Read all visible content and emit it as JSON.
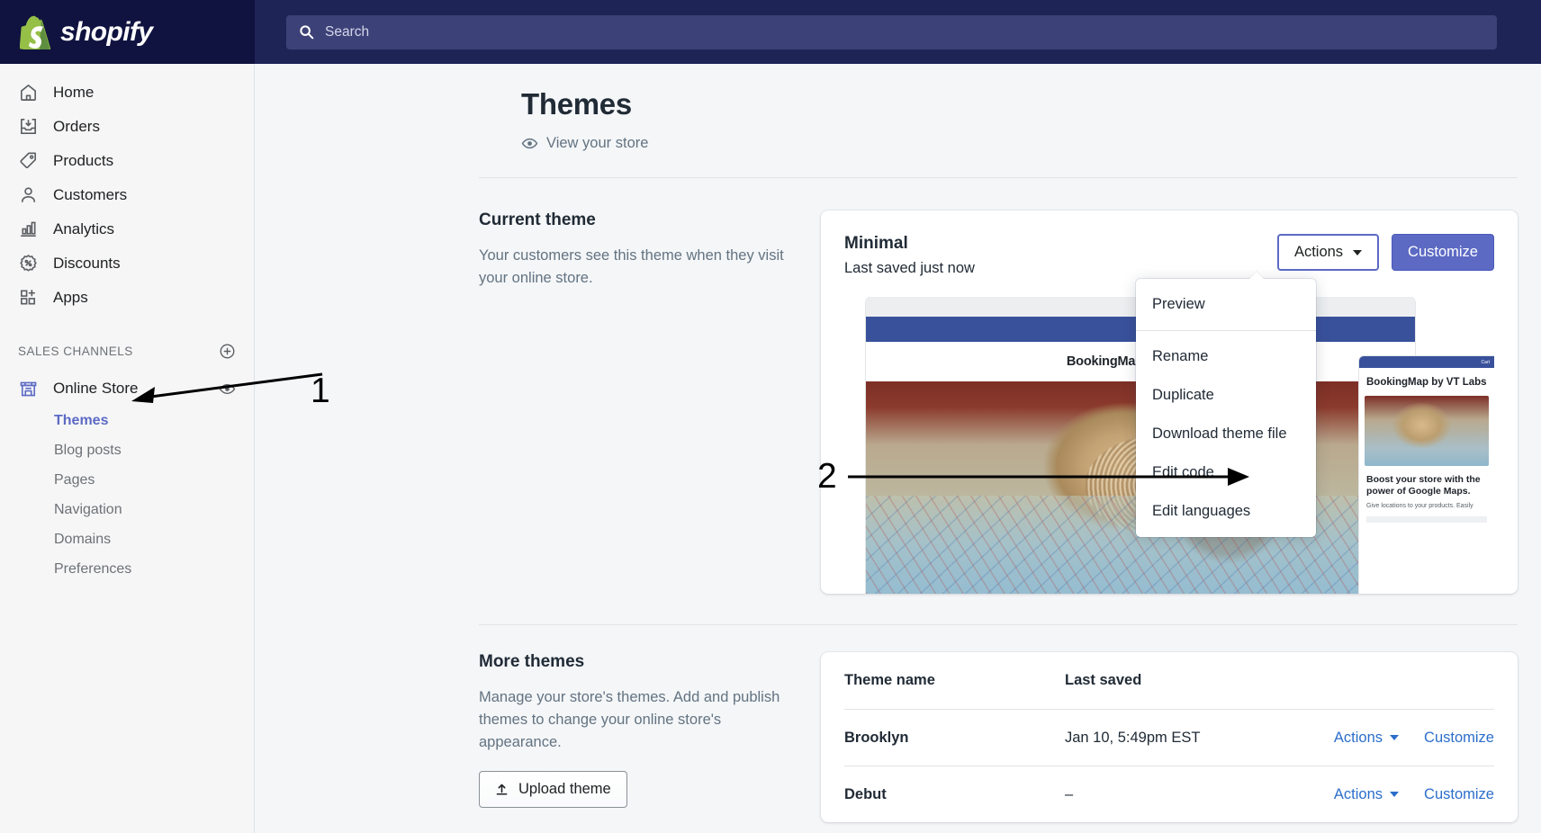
{
  "topbar": {
    "brand_name": "shopify",
    "brand_logo_icon": "shopify-bag-icon",
    "search_icon": "search-icon",
    "search_placeholder": "Search",
    "search_value": ""
  },
  "sidebar": {
    "items": [
      {
        "label": "Home",
        "icon": "home-icon"
      },
      {
        "label": "Orders",
        "icon": "orders-inbox-icon"
      },
      {
        "label": "Products",
        "icon": "product-tag-icon"
      },
      {
        "label": "Customers",
        "icon": "customer-person-icon"
      },
      {
        "label": "Analytics",
        "icon": "analytics-bar-chart-icon"
      },
      {
        "label": "Discounts",
        "icon": "discount-percent-icon"
      },
      {
        "label": "Apps",
        "icon": "apps-grid-plus-icon"
      }
    ],
    "sales_channels": {
      "title": "SALES CHANNELS",
      "add_icon": "plus-circle-icon",
      "store": {
        "label": "Online Store",
        "icon": "storefront-icon",
        "view_icon": "eye-icon"
      },
      "sub_items": [
        {
          "label": "Themes",
          "active": true
        },
        {
          "label": "Blog posts",
          "active": false
        },
        {
          "label": "Pages",
          "active": false
        },
        {
          "label": "Navigation",
          "active": false
        },
        {
          "label": "Domains",
          "active": false
        },
        {
          "label": "Preferences",
          "active": false
        }
      ]
    }
  },
  "page": {
    "title": "Themes",
    "view_store_label": "View your store",
    "view_store_icon": "eye-icon"
  },
  "current_theme": {
    "section_title": "Current theme",
    "section_desc": "Your customers see this theme when they visit your online store.",
    "name": "Minimal",
    "last_saved": "Last saved just now",
    "actions_label": "Actions",
    "customize_label": "Customize",
    "preview": {
      "desktop_brand": "BookingMap by VT Labs",
      "mobile_title": "BookingMap by VT Labs",
      "mobile_cart": "Cart",
      "mobile_heading": "Boost your store with the power of Google Maps.",
      "mobile_body": "Give locations to your products. Easily"
    }
  },
  "actions_dropdown": {
    "items": [
      {
        "label": "Preview",
        "separator_after": true
      },
      {
        "label": "Rename",
        "separator_after": false
      },
      {
        "label": "Duplicate",
        "separator_after": false
      },
      {
        "label": "Download theme file",
        "separator_after": false
      },
      {
        "label": "Edit code",
        "separator_after": false
      },
      {
        "label": "Edit languages",
        "separator_after": false
      }
    ]
  },
  "more_themes": {
    "section_title": "More themes",
    "section_desc": "Manage your store's themes. Add and publish themes to change your online store's appearance.",
    "upload_label": "Upload theme",
    "upload_icon": "upload-icon",
    "columns": [
      "Theme name",
      "Last saved"
    ],
    "rows": [
      {
        "name": "Brooklyn",
        "last_saved": "Jan 10, 5:49pm EST",
        "actions_label": "Actions",
        "customize_label": "Customize"
      },
      {
        "name": "Debut",
        "last_saved": "–",
        "actions_label": "Actions",
        "customize_label": "Customize"
      }
    ]
  },
  "annotations": [
    {
      "number": "1",
      "target": "themes-sidebar-link"
    },
    {
      "number": "2",
      "target": "edit-code-menu-item"
    }
  ],
  "colors": {
    "topbar": "#1f2457",
    "brand_block": "#10133f",
    "accent": "#5c6ac4",
    "link": "#2c6ecb",
    "page_bg": "#f4f6f8",
    "sidebar_bg": "#f6f6f7"
  }
}
